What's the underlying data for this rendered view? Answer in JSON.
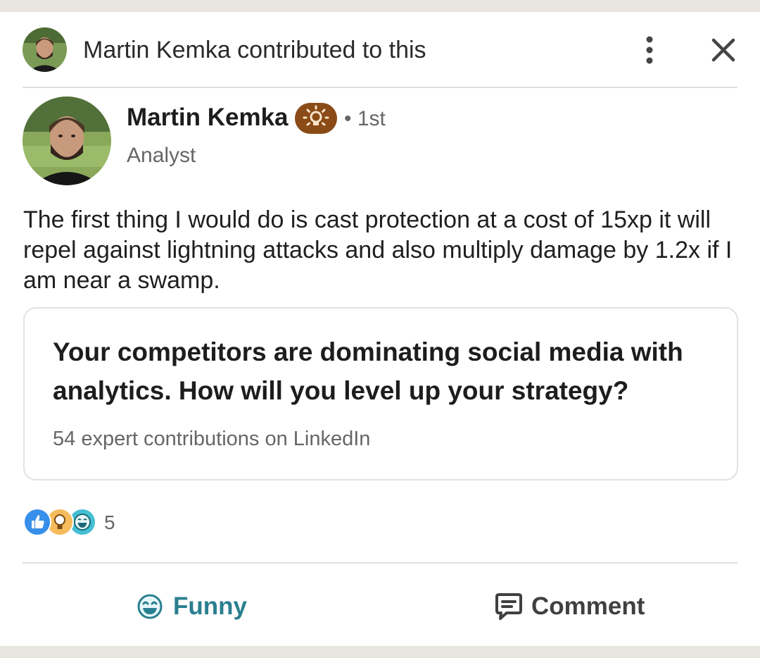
{
  "header": {
    "contributor_name": "Martin Kemka",
    "contributed_text": " contributed to this"
  },
  "author": {
    "name": "Martin Kemka",
    "degree": "• 1st",
    "headline": "Analyst"
  },
  "post": {
    "text": "The first thing I would do is cast protection at a cost of 15xp it will repel against lightning attacks and also multiply damage by 1.2x if I am near a swamp."
  },
  "article": {
    "title": "Your competitors are dominating social media with analytics. How will you level up your strategy?",
    "meta": "54 expert contributions on LinkedIn"
  },
  "reactions": {
    "icons": [
      "like-icon",
      "insightful-icon",
      "funny-icon"
    ],
    "count": "5"
  },
  "actions": {
    "funny_label": "Funny",
    "comment_label": "Comment"
  },
  "colors": {
    "accent_teal": "#2a7f8f",
    "badge_brown": "#8a4b17",
    "like_blue": "#378fe9",
    "insight_yellow": "#f5bb5c"
  }
}
